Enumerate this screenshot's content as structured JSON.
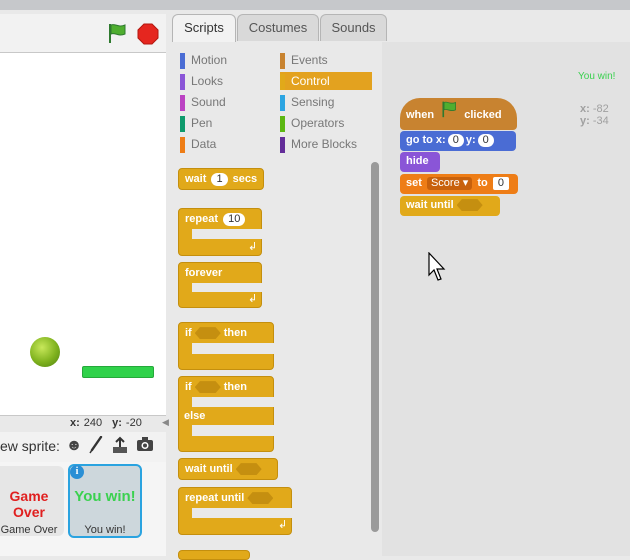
{
  "tabs": [
    {
      "label": "Scripts",
      "active": true
    },
    {
      "label": "Costumes",
      "active": false
    },
    {
      "label": "Sounds",
      "active": false
    }
  ],
  "categories": {
    "left": [
      {
        "label": "Motion",
        "color": "#4a6cd4"
      },
      {
        "label": "Looks",
        "color": "#8a55d7"
      },
      {
        "label": "Sound",
        "color": "#bb42c3"
      },
      {
        "label": "Pen",
        "color": "#0e9a6c"
      },
      {
        "label": "Data",
        "color": "#ee7d16"
      }
    ],
    "right": [
      {
        "label": "Events",
        "color": "#c88330"
      },
      {
        "label": "Control",
        "color": "#e1a91a",
        "active": true
      },
      {
        "label": "Sensing",
        "color": "#2ca5e2"
      },
      {
        "label": "Operators",
        "color": "#5cb712"
      },
      {
        "label": "More Blocks",
        "color": "#632d99"
      }
    ]
  },
  "palette_blocks": {
    "wait_secs": {
      "word1": "wait",
      "value": "1",
      "word2": "secs"
    },
    "repeat": {
      "word": "repeat",
      "value": "10"
    },
    "forever": {
      "word": "forever"
    },
    "if_then": {
      "word1": "if",
      "word2": "then"
    },
    "if_then_else": {
      "word1": "if",
      "word2": "then",
      "word3": "else"
    },
    "wait_until": {
      "word": "wait until"
    },
    "repeat_until": {
      "word": "repeat until"
    }
  },
  "stage": {
    "coords": {
      "x_label": "x:",
      "x_value": "240",
      "y_label": "y:",
      "y_value": "-20"
    },
    "new_sprite_label": "ew sprite:"
  },
  "sprites": [
    {
      "thumb_text": "Game Over",
      "thumb_color": "#e01f1f",
      "name": "Game Over",
      "selected": false
    },
    {
      "thumb_text": "You win!",
      "thumb_color": "#3ad14f",
      "name": "You win!",
      "selected": true
    }
  ],
  "script": {
    "hat": {
      "word1": "when",
      "word2": "clicked"
    },
    "goto": {
      "word1": "go to x:",
      "x": "0",
      "word2": "y:",
      "y": "0"
    },
    "hide": {
      "word": "hide"
    },
    "set": {
      "word1": "set",
      "var": "Score",
      "word2": "to",
      "value": "0"
    },
    "wait_until": {
      "word": "wait until"
    }
  },
  "sprite_info": {
    "name_tag": "You win!",
    "x_label": "x:",
    "x_value": "-82",
    "y_label": "y:",
    "y_value": "-34"
  },
  "colors": {
    "control": "#e1a91a",
    "motion": "#4a6cd4",
    "looks": "#8a55d7",
    "data": "#ee7d16",
    "events": "#c88330"
  }
}
